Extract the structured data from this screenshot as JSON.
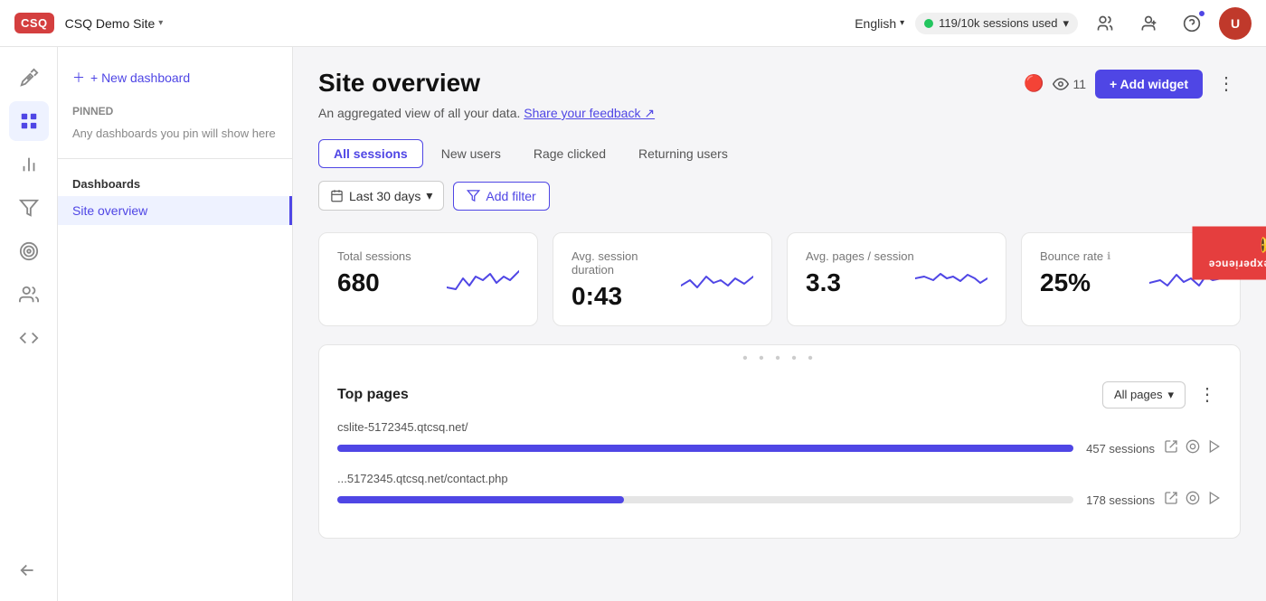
{
  "app": {
    "logo": "CSQ",
    "site_name": "CSQ Demo Site",
    "language": "English",
    "sessions_used": "119/10k sessions used"
  },
  "navbar": {
    "language_label": "English",
    "sessions_label": "119/10k sessions used",
    "collapse_label": "Collapse sidebar"
  },
  "sidebar": {
    "icons": [
      {
        "name": "rocket-icon",
        "glyph": "🚀",
        "active": false
      },
      {
        "name": "dashboard-icon",
        "glyph": "⊞",
        "active": true
      },
      {
        "name": "chart-icon",
        "glyph": "📊",
        "active": false
      },
      {
        "name": "funnel-icon",
        "glyph": "⇥",
        "active": false
      },
      {
        "name": "target-icon",
        "glyph": "◎",
        "active": false
      },
      {
        "name": "user-icon",
        "glyph": "👤",
        "active": false
      },
      {
        "name": "tools-icon",
        "glyph": "⚙",
        "active": false
      }
    ]
  },
  "content_sidebar": {
    "new_dashboard_label": "+ New dashboard",
    "pinned_section": "Pinned",
    "pinned_hint": "Any dashboards you pin will show here",
    "dashboards_section": "Dashboards",
    "dashboard_items": [
      {
        "label": "Site overview",
        "active": true
      }
    ]
  },
  "page": {
    "title": "Site overview",
    "description": "An aggregated view of all your data.",
    "feedback_link": "Share your feedback",
    "views_count": "11",
    "add_widget_label": "+ Add widget",
    "tabs": [
      {
        "label": "All sessions",
        "active": true
      },
      {
        "label": "New users"
      },
      {
        "label": "Rage clicked"
      },
      {
        "label": "Returning users"
      }
    ],
    "date_filter": "Last 30 days",
    "add_filter_label": "Add filter"
  },
  "metrics": [
    {
      "label": "Total sessions",
      "value": "680",
      "chart_type": "sparkline"
    },
    {
      "label": "Avg. session duration",
      "value": "0:43",
      "chart_type": "sparkline"
    },
    {
      "label": "Avg. pages / session",
      "value": "3.3",
      "chart_type": "sparkline"
    },
    {
      "label": "Bounce rate",
      "value": "25%",
      "has_info": true,
      "chart_type": "sparkline"
    }
  ],
  "top_pages": {
    "title": "Top pages",
    "filter_label": "All pages",
    "rows": [
      {
        "url": "cslite-5172345.qtcsq.net/",
        "sessions": "457 sessions",
        "bar_pct": 100
      },
      {
        "url": "...5172345.qtcsq.net/contact.php",
        "sessions": "178 sessions",
        "bar_pct": 39
      }
    ]
  },
  "rate_tab": {
    "label": "Rate your experience"
  }
}
